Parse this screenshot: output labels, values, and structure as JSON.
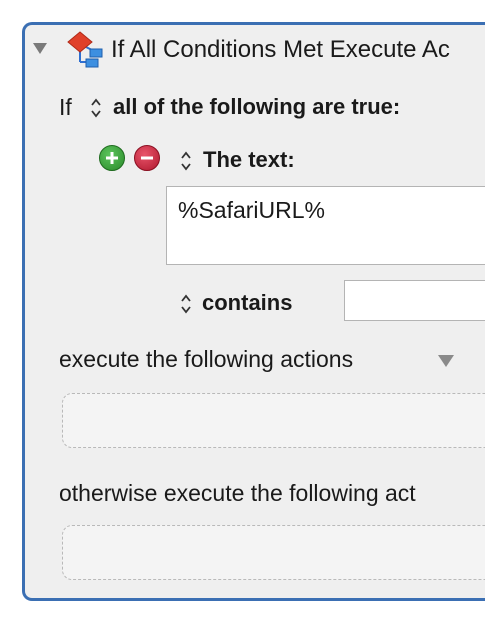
{
  "action": {
    "title": "If All Conditions Met Execute Ac",
    "icon": "if-then-action-icon"
  },
  "condition_header": {
    "if_label": "If",
    "match_mode": "all of the following are true:"
  },
  "condition": {
    "type_label": "The text:",
    "text_value": "%SafariURL%",
    "operator_label": "contains",
    "operand_value": ""
  },
  "then_block": {
    "label": "execute the following actions"
  },
  "else_block": {
    "label": "otherwise execute the following act"
  },
  "colors": {
    "panel_border": "#3b6fb3",
    "panel_bg": "#efefef",
    "add_button": "#2a8a2a",
    "remove_button": "#b0182e"
  }
}
